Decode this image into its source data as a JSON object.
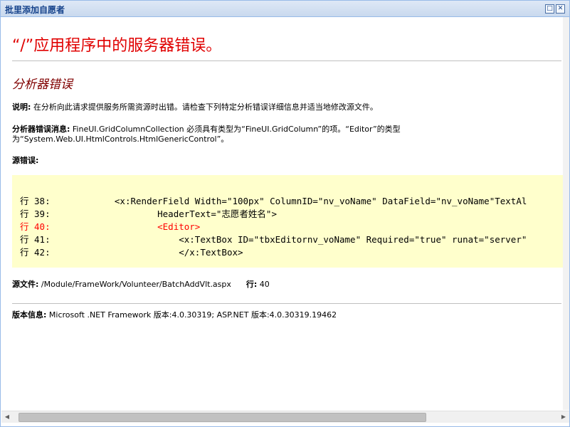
{
  "window": {
    "title": "批里添加自愿者",
    "maximize_glyph": "□",
    "close_glyph": "✕"
  },
  "error": {
    "heading": "“/”应用程序中的服务器错误。",
    "subheading": "分析器错误",
    "description_label": "说明:",
    "description": "在分析向此请求提供服务所需资源时出错。请检查下列特定分析错误详细信息并适当地修改源文件。",
    "message_label": "分析器错误消息:",
    "message_line1": "FineUI.GridColumnCollection 必须具有类型为“FineUI.GridColumn”的项。“Editor”的类型",
    "message_line2": "为“System.Web.UI.HtmlControls.HtmlGenericControl”。",
    "source_label": "源错误:",
    "source_lines": [
      {
        "text": "行 38:            <x:RenderField Width=\"100px\" ColumnID=\"nv_voName\" DataField=\"nv_voName\"TextAl",
        "error": false
      },
      {
        "text": "行 39:                    HeaderText=\"志愿者姓名\">",
        "error": false
      },
      {
        "text": "行 40:                    <Editor>",
        "error": true
      },
      {
        "text": "行 41:                        <x:TextBox ID=\"tbxEditornv_voName\" Required=\"true\" runat=\"server\"",
        "error": false
      },
      {
        "text": "行 42:                        </x:TextBox>",
        "error": false
      }
    ],
    "file_label": "源文件:",
    "file_path": "/Module/FrameWork/Volunteer/BatchAddVlt.aspx",
    "line_label": "行:",
    "line_number": "40",
    "version_label": "版本信息:",
    "version": "Microsoft .NET Framework 版本:4.0.30319; ASP.NET 版本:4.0.30319.19462"
  },
  "scrollbar": {
    "left_arrow": "◀",
    "right_arrow": "▶"
  },
  "colors": {
    "title_text": "#15428b",
    "heading_red": "#e00000",
    "subheading": "#800000",
    "code_background": "#ffffcc",
    "error_line": "#ff0000"
  }
}
